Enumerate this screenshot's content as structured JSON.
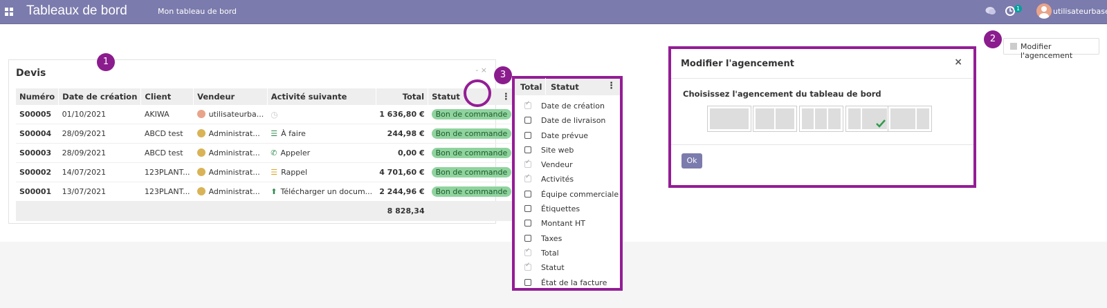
{
  "topbar": {
    "app_title": "Tableaux de bord",
    "menu_item": "Mon tableau de bord",
    "activity_badge": "1",
    "user_name": "utilisateurbase",
    "bar_color": "#7c7bad"
  },
  "callouts": [
    "1",
    "2",
    "3"
  ],
  "devis": {
    "title": "Devis",
    "controls": "- ×",
    "columns": [
      "Numéro",
      "Date de création",
      "Client",
      "Vendeur",
      "Activité suivante",
      "Total",
      "Statut"
    ],
    "rows": [
      {
        "numero": "S00005",
        "date": "01/10/2021",
        "client": "AKIWA",
        "vendeur": "utilisateurba...",
        "activite": "",
        "activity_icon": "clock-icon",
        "total": "1 636,80 €",
        "statut": "Bon de commande"
      },
      {
        "numero": "S00004",
        "date": "28/09/2021",
        "client": "ABCD test",
        "vendeur": "Administrat...",
        "activite": "À faire",
        "activity_icon": "todo-list-icon",
        "total": "244,98 €",
        "statut": "Bon de commande"
      },
      {
        "numero": "S00003",
        "date": "28/09/2021",
        "client": "ABCD test",
        "vendeur": "Administrat...",
        "activite": "Appeler",
        "activity_icon": "phone-icon",
        "total": "0,00 €",
        "statut": "Bon de commande"
      },
      {
        "numero": "S00002",
        "date": "14/07/2021",
        "client": "123PLANT...",
        "vendeur": "Administrat...",
        "activite": "Rappel",
        "activity_icon": "reminder-icon",
        "total": "4 701,60 €",
        "statut": "Bon de commande"
      },
      {
        "numero": "S00001",
        "date": "13/07/2021",
        "client": "123PLANT...",
        "vendeur": "Administrat...",
        "activite": "Télécharger un docum...",
        "activity_icon": "upload-icon",
        "total": "2 244,96 €",
        "statut": "Bon de commande"
      }
    ],
    "grand_total": "8 828,34",
    "status_color": "#8fd39e"
  },
  "column_panel": {
    "header_total": "Total",
    "header_statut": "Statut",
    "items": [
      {
        "label": "Date de création",
        "checked": true
      },
      {
        "label": "Date de livraison",
        "checked": false
      },
      {
        "label": "Date prévue",
        "checked": false
      },
      {
        "label": "Site web",
        "checked": false
      },
      {
        "label": "Vendeur",
        "checked": true
      },
      {
        "label": "Activités",
        "checked": true
      },
      {
        "label": "Équipe commerciale",
        "checked": false
      },
      {
        "label": "Étiquettes",
        "checked": false
      },
      {
        "label": "Montant HT",
        "checked": false
      },
      {
        "label": "Taxes",
        "checked": false
      },
      {
        "label": "Total",
        "checked": true
      },
      {
        "label": "Statut",
        "checked": true
      },
      {
        "label": "État de la facture",
        "checked": false
      }
    ]
  },
  "layout_modal": {
    "title": "Modifier l'agencement",
    "close": "×",
    "subtitle": "Choisissez l'agencement du tableau de bord",
    "selected_index": 3,
    "ok_label": "Ok"
  },
  "edit_layout_button": "Modifier l'agencement",
  "highlight_color": "#941d96"
}
